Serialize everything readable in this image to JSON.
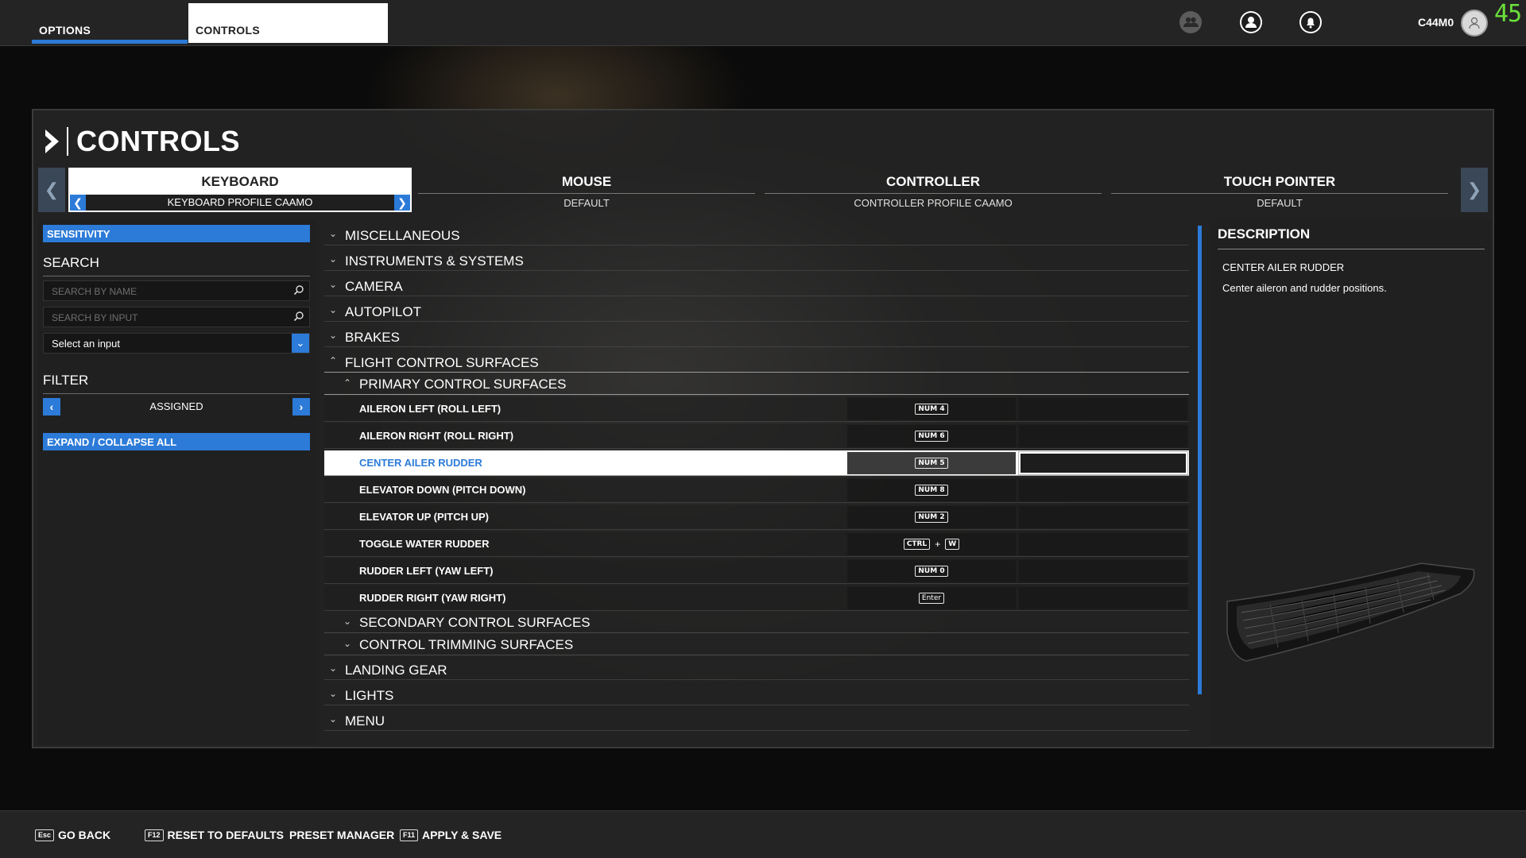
{
  "topbar": {
    "tabs": [
      "OPTIONS",
      "CONTROLS"
    ],
    "username": "C44M0",
    "fps": "45",
    "icons": [
      "group-icon",
      "profile-icon",
      "notification-icon",
      "avatar-icon"
    ]
  },
  "panel": {
    "title": "CONTROLS",
    "devices": [
      {
        "name": "KEYBOARD",
        "profile": "KEYBOARD PROFILE CAAMO",
        "active": true
      },
      {
        "name": "MOUSE",
        "profile": "DEFAULT"
      },
      {
        "name": "CONTROLLER",
        "profile": "CONTROLLER PROFILE CAAMO"
      },
      {
        "name": "TOUCH POINTER",
        "profile": "DEFAULT"
      }
    ]
  },
  "sidebar": {
    "sensitivity": "SENSITIVITY",
    "search_title": "SEARCH",
    "search_name_placeholder": "SEARCH BY NAME",
    "search_input_placeholder": "SEARCH BY INPUT",
    "select_input": "Select an input",
    "filter_title": "FILTER",
    "filter_value": "ASSIGNED",
    "expand_collapse": "EXPAND / COLLAPSE ALL"
  },
  "list": {
    "categories_top": [
      "MISCELLANEOUS",
      "INSTRUMENTS & SYSTEMS",
      "CAMERA",
      "AUTOPILOT",
      "BRAKES",
      "FLIGHT CONTROL SURFACES"
    ],
    "primary": "PRIMARY CONTROL SURFACES",
    "bindings": [
      {
        "label": "AILERON LEFT (ROLL LEFT)",
        "keys": [
          "NUM 4"
        ]
      },
      {
        "label": "AILERON RIGHT (ROLL RIGHT)",
        "keys": [
          "NUM 6"
        ]
      },
      {
        "label": "CENTER AILER RUDDER",
        "keys": [
          "NUM 5"
        ],
        "selected": true
      },
      {
        "label": "ELEVATOR DOWN (PITCH DOWN)",
        "keys": [
          "NUM 8"
        ]
      },
      {
        "label": "ELEVATOR UP (PITCH UP)",
        "keys": [
          "NUM 2"
        ]
      },
      {
        "label": "TOGGLE WATER RUDDER",
        "keys": [
          "CTRL",
          "W"
        ]
      },
      {
        "label": "RUDDER LEFT (YAW LEFT)",
        "keys": [
          "NUM 0"
        ]
      },
      {
        "label": "RUDDER RIGHT (YAW RIGHT)",
        "keys": [
          "Enter"
        ]
      }
    ],
    "subs_after": [
      "SECONDARY CONTROL SURFACES",
      "CONTROL TRIMMING SURFACES"
    ],
    "categories_bottom": [
      "LANDING GEAR",
      "LIGHTS",
      "MENU"
    ]
  },
  "description": {
    "title": "DESCRIPTION",
    "name": "CENTER AILER RUDDER",
    "text": "Center aileron and rudder positions."
  },
  "bottombar": {
    "go_back": {
      "key": "Esc",
      "label": "GO BACK"
    },
    "reset": {
      "key": "F12",
      "label": "RESET TO DEFAULTS"
    },
    "preset": {
      "label": "PRESET MANAGER"
    },
    "apply": {
      "key": "F11",
      "label": "APPLY & SAVE"
    }
  },
  "colors": {
    "accent": "#2c7bd8",
    "fps": "#6be03a"
  }
}
